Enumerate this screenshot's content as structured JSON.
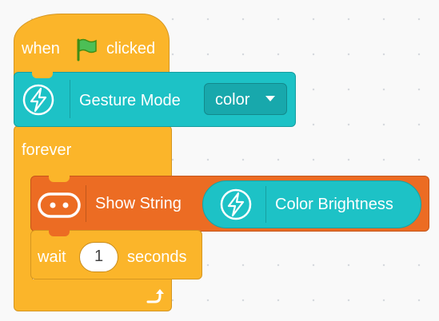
{
  "hat": {
    "when": "when",
    "clicked": "clicked",
    "flag_icon": "green-flag-icon"
  },
  "gesture_block": {
    "label": "Gesture Mode",
    "selected_mode": "color",
    "icon": "lightning-icon"
  },
  "forever_block": {
    "label": "forever",
    "loop_icon": "loop-arrow-icon"
  },
  "show_string_block": {
    "label": "Show String",
    "icon": "led-matrix-icon",
    "reporter": {
      "label": "Color Brightness",
      "icon": "lightning-icon"
    }
  },
  "wait_block": {
    "wait": "wait",
    "value": "1",
    "unit": "seconds"
  },
  "colors": {
    "control": "#fbb52a",
    "sensor": "#1dc2c6",
    "display": "#ec6c23"
  }
}
